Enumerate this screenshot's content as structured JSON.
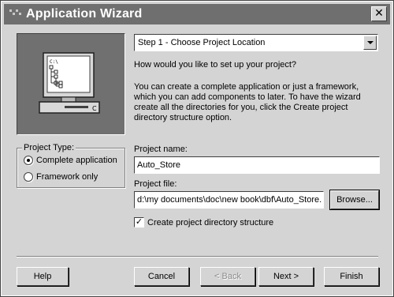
{
  "window": {
    "title": "Application Wizard",
    "close_glyph": "✕"
  },
  "step": {
    "selected": "Step 1 - Choose Project Location"
  },
  "intro": {
    "question": "How would you like to set up your project?",
    "line1": "You can create a complete application or just a framework,",
    "line2": "which you can add components to later.  To have the wizard",
    "line3": "create all the directories for you, click the Create project",
    "line4": "directory structure option."
  },
  "project_type": {
    "legend": "Project Type:",
    "options": [
      {
        "label": "Complete application",
        "selected": true
      },
      {
        "label": "Framework only",
        "selected": false
      }
    ]
  },
  "project_name": {
    "label": "Project name:",
    "value": "Auto_Store"
  },
  "project_file": {
    "label": "Project file:",
    "value": "d:\\my documents\\doc\\new book\\dbf\\Auto_Store.",
    "browse_label": "Browse..."
  },
  "create_dir": {
    "label": "Create project directory structure",
    "checked": true,
    "check_glyph": "✓"
  },
  "buttons": {
    "help": "Help",
    "cancel": "Cancel",
    "back": "< Back",
    "next": "Next >",
    "finish": "Finish"
  },
  "graphic": {
    "drive_label": "C:\\",
    "base_label": "C"
  }
}
